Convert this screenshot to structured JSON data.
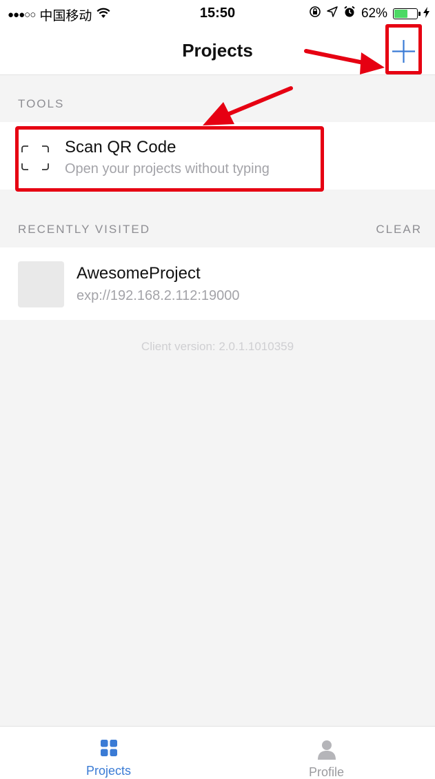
{
  "status_bar": {
    "signal": "●●●○○",
    "carrier": "中国移动",
    "time": "15:50",
    "battery_percent": "62%",
    "battery_level": 0.62,
    "icons": [
      "wifi-icon",
      "orientation-lock-icon",
      "location-icon",
      "alarm-icon",
      "battery-icon",
      "charging-bolt-icon"
    ]
  },
  "nav": {
    "title": "Projects",
    "add_icon": "plus-icon"
  },
  "tools": {
    "header": "TOOLS",
    "scan_title": "Scan QR Code",
    "scan_subtitle": "Open your projects without typing",
    "scan_icon": "qr-scan-icon"
  },
  "recent": {
    "header": "RECENTLY VISITED",
    "clear_label": "CLEAR",
    "projects": [
      {
        "name": "AwesomeProject",
        "url": "exp://192.168.2.112:19000"
      }
    ]
  },
  "footer": {
    "client_version": "Client version: 2.0.1.1010359"
  },
  "tabs": [
    {
      "label": "Projects",
      "icon": "grid-icon",
      "active": true
    },
    {
      "label": "Profile",
      "icon": "person-icon",
      "active": false
    }
  ],
  "colors": {
    "accent": "#3a7bd5",
    "annotation_red": "#e60012",
    "background": "#f4f4f4"
  }
}
